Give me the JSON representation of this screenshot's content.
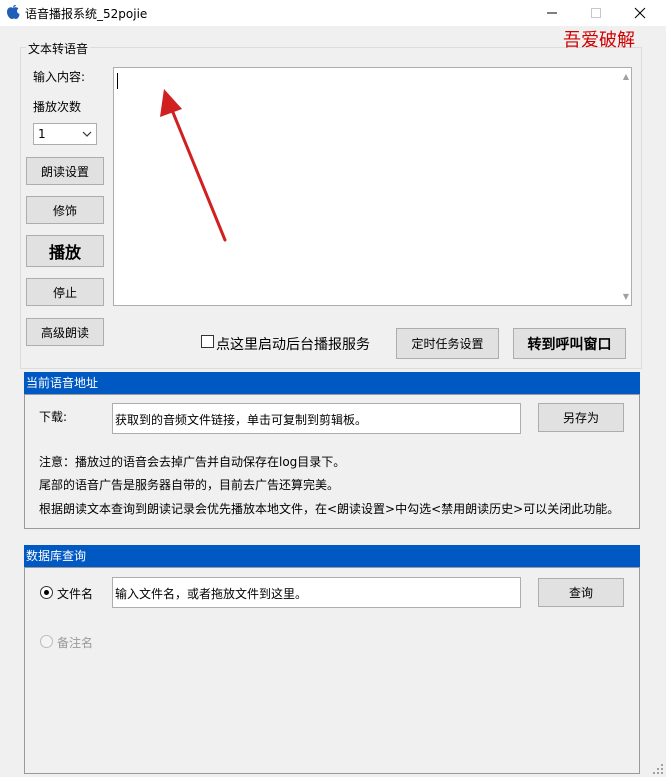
{
  "window": {
    "title": "语音播报系统_52pojie",
    "minimize_icon": "minimize-icon",
    "maximize_icon": "maximize-icon",
    "close_icon": "close-icon"
  },
  "tts_group": {
    "label": "文本转语音",
    "watermark": "吾爱破解",
    "input_label": "输入内容:",
    "times_label": "播放次数",
    "times_value": "1",
    "text_value": "",
    "buttons": {
      "read_settings": "朗读设置",
      "decorate": "修饰",
      "play": "播放",
      "stop": "停止",
      "advanced": "高级朗读",
      "timer_task": "定时任务设置",
      "call_window": "转到呼叫窗口"
    },
    "bg_service_label": "点这里启动后台播报服务",
    "bg_service_checked": false
  },
  "address_group": {
    "header": "当前语音地址",
    "download_label": "下载:",
    "download_value": "获取到的音频文件链接，单击可复制到剪辑板。",
    "save_as": "另存为",
    "notes": [
      "注意：播放过的语音会去掉广告并自动保存在log目录下。",
      "尾部的语音广告是服务器自带的，目前去广告还算完美。",
      "根据朗读文本查询到朗读记录会优先播放本地文件，在<朗读设置>中勾选<禁用朗读历史>可以关闭此功能。"
    ]
  },
  "db_group": {
    "header": "数据库查询",
    "radio_filename": "文件名",
    "radio_remark": "备注名",
    "selected": "文件名",
    "query_value": "输入文件名，或者拖放文件到这里。",
    "query_button": "查询"
  },
  "colors": {
    "panel_header": "#0058c2",
    "watermark": "#d00000",
    "annotation_arrow": "#d02020"
  }
}
